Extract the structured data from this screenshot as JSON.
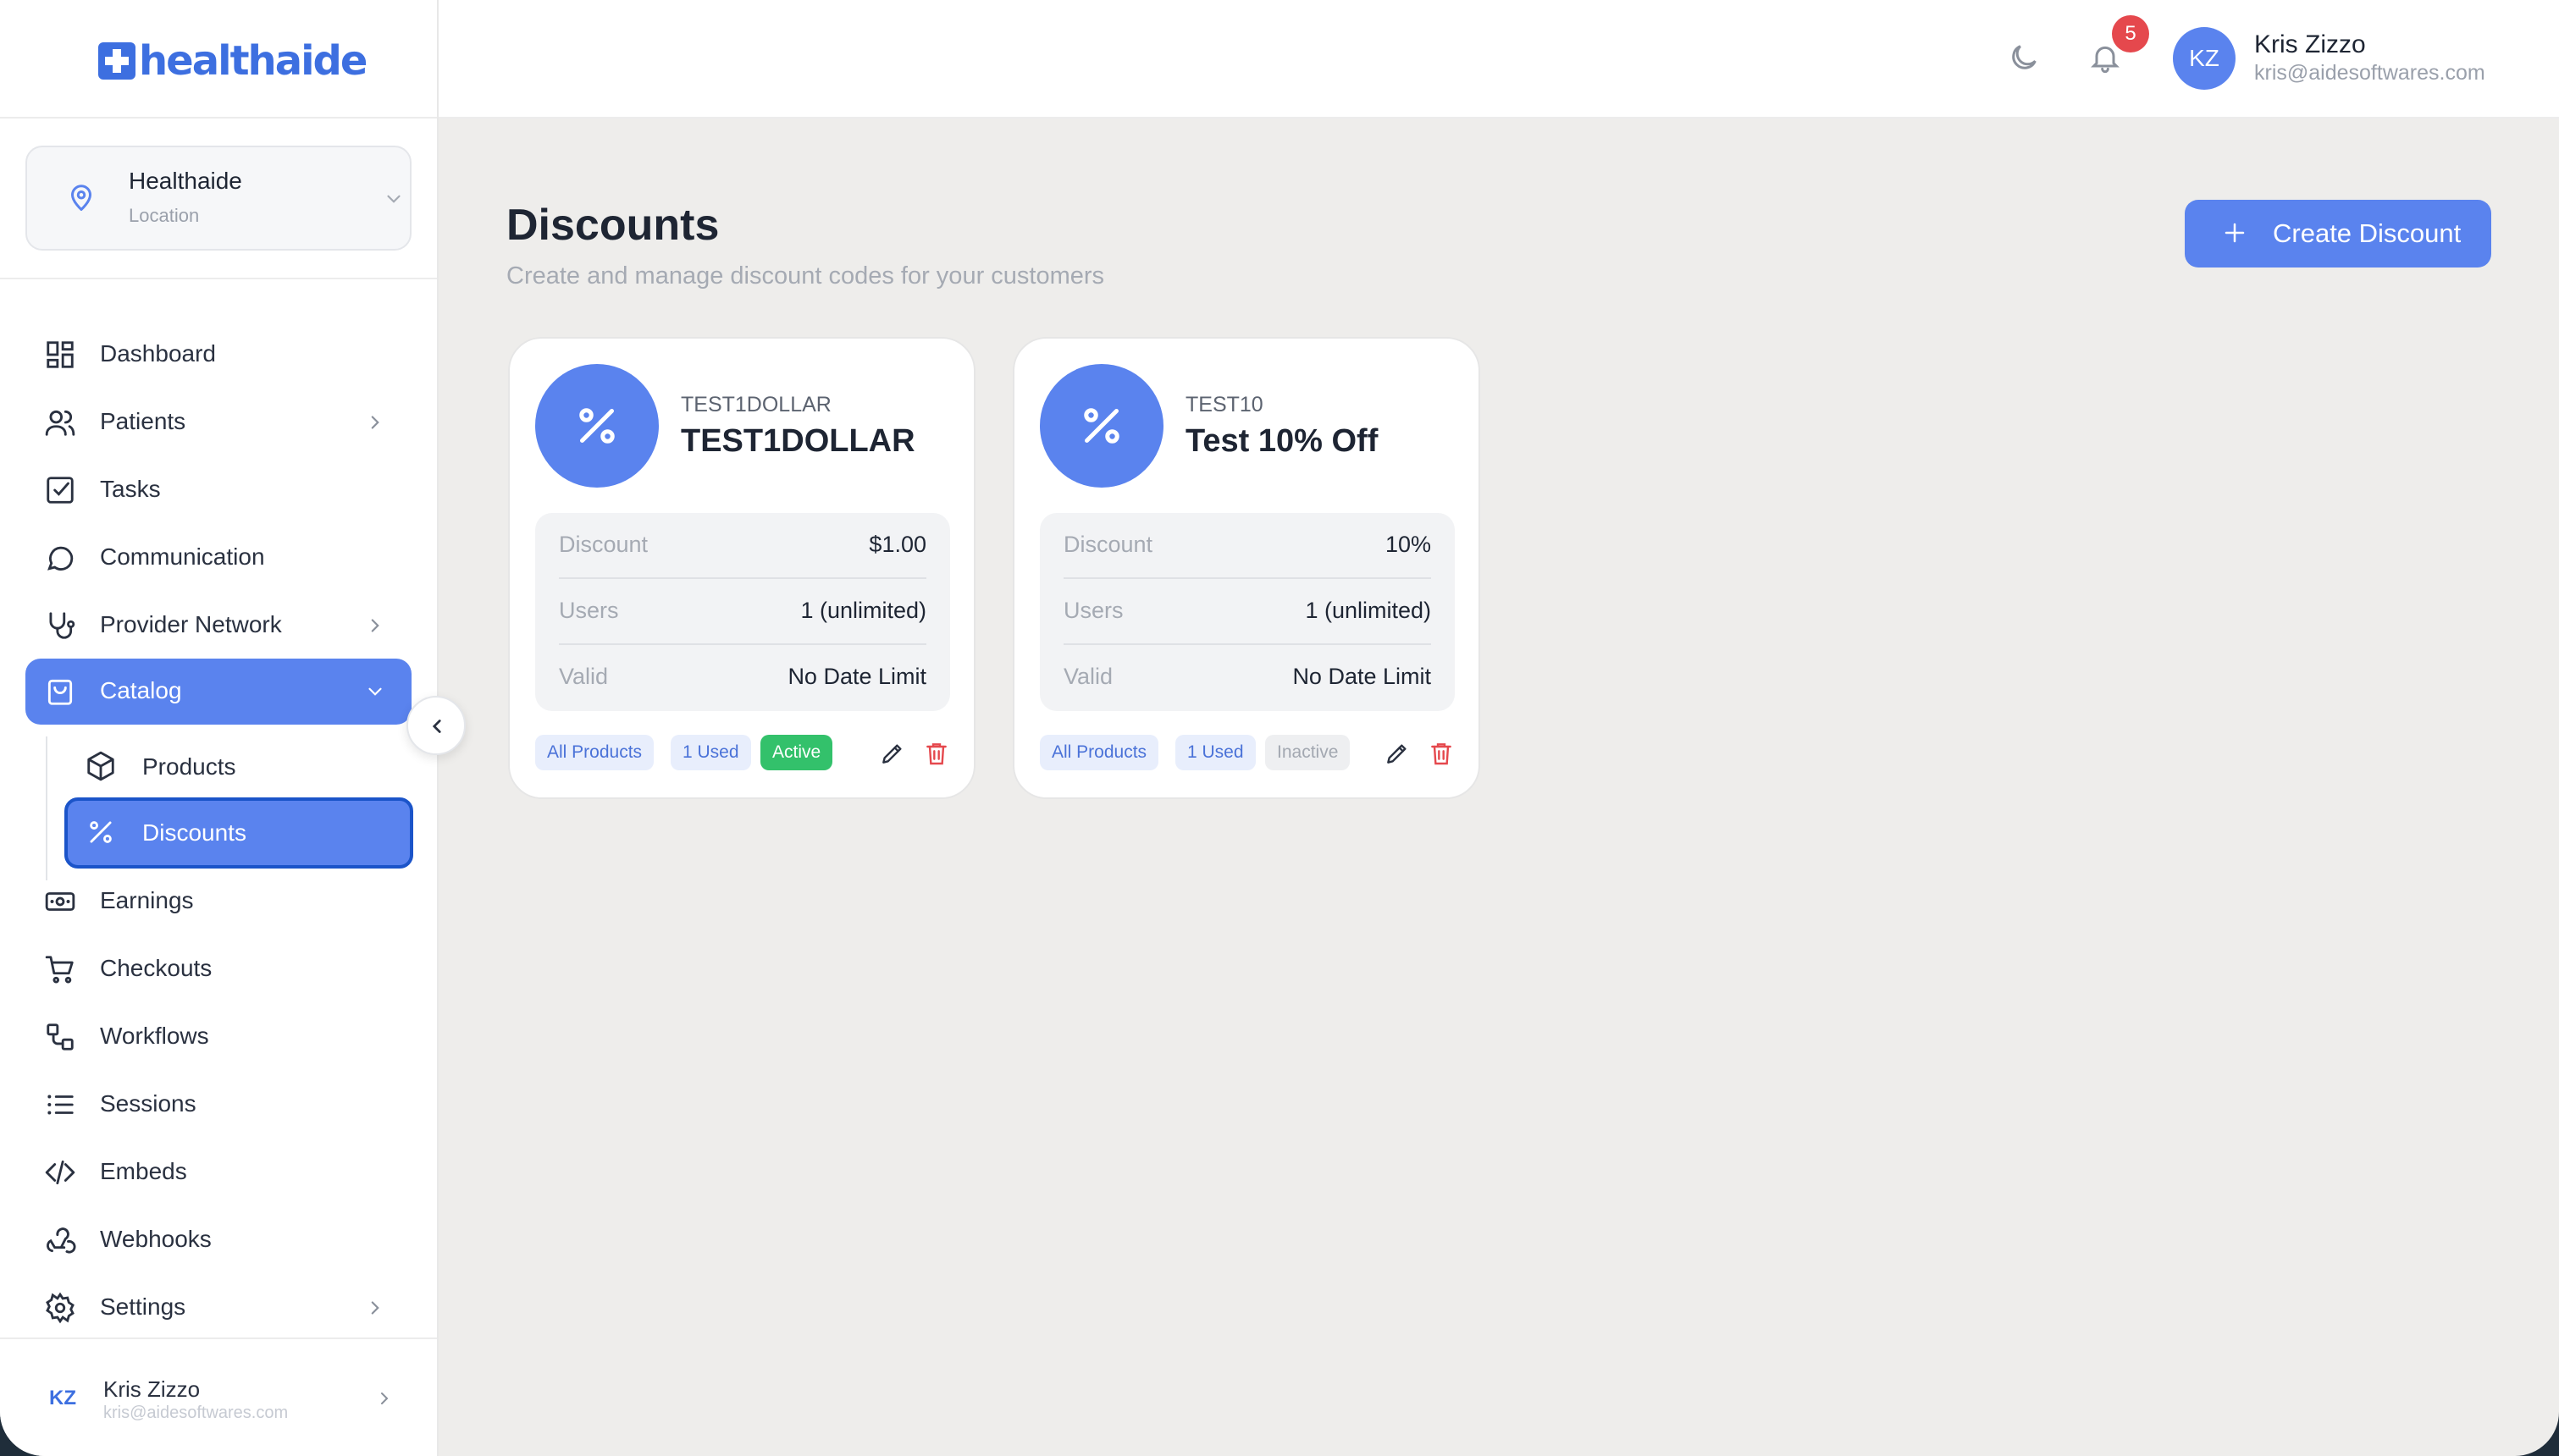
{
  "logo": {
    "text": "healthaide"
  },
  "location": {
    "name": "Healthaide",
    "label": "Location"
  },
  "nav": {
    "items": [
      {
        "label": "Dashboard",
        "icon": "dashboard-icon"
      },
      {
        "label": "Patients",
        "icon": "users-icon"
      },
      {
        "label": "Tasks",
        "icon": "checkbox-icon"
      },
      {
        "label": "Communication",
        "icon": "chat-icon"
      },
      {
        "label": "Provider Network",
        "icon": "stethoscope-icon"
      },
      {
        "label": "Catalog",
        "icon": "shopping-bag-icon"
      },
      {
        "label": "Earnings",
        "icon": "banknote-icon"
      },
      {
        "label": "Checkouts",
        "icon": "cart-icon"
      },
      {
        "label": "Workflows",
        "icon": "workflow-icon"
      },
      {
        "label": "Sessions",
        "icon": "list-icon"
      },
      {
        "label": "Embeds",
        "icon": "code-icon"
      },
      {
        "label": "Webhooks",
        "icon": "webhook-icon"
      },
      {
        "label": "Settings",
        "icon": "gear-icon"
      }
    ],
    "catalog_sub": [
      {
        "label": "Products",
        "icon": "box-icon"
      },
      {
        "label": "Discounts",
        "icon": "percent-icon"
      }
    ]
  },
  "footer_user": {
    "initials": "KZ",
    "name": "Kris Zizzo",
    "email": "kris@aidesoftwares.com"
  },
  "header": {
    "notifications": "5",
    "avatar_initials": "KZ",
    "user_name": "Kris Zizzo",
    "user_email": "kris@aidesoftwares.com"
  },
  "page": {
    "title": "Discounts",
    "subtitle": "Create and manage discount codes for your customers",
    "create_label": "Create Discount"
  },
  "discounts": [
    {
      "code": "TEST1DOLLAR",
      "name": "TEST1DOLLAR",
      "discount_label": "Discount",
      "discount": "$1.00",
      "users_label": "Users",
      "users": "1 (unlimited)",
      "valid_label": "Valid",
      "valid": "No Date Limit",
      "scope": "All Products",
      "used": "1 Used",
      "status": "Active"
    },
    {
      "code": "TEST10",
      "name": "Test 10% Off",
      "discount_label": "Discount",
      "discount": "10%",
      "users_label": "Users",
      "users": "1 (unlimited)",
      "valid_label": "Valid",
      "valid": "No Date Limit",
      "scope": "All Products",
      "used": "1 Used",
      "status": "Inactive"
    }
  ],
  "colors": {
    "accent": "#5a83ee",
    "active_border": "#1b54c9",
    "status_active": "#33c16b",
    "danger": "#e5484d"
  }
}
